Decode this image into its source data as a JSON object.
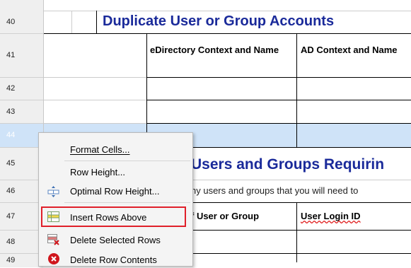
{
  "row_headers": [
    "40",
    "41",
    "42",
    "43",
    "44",
    "45",
    "46",
    "47",
    "48",
    "49"
  ],
  "sheet": {
    "section1_title": "Duplicate User or Group Accounts",
    "col_edirectory": "eDirectory Context and Name",
    "col_ad": "AD Context and Name",
    "section2_title": "Users and Groups Requirin",
    "section2_desc": "ny users and groups that you will need to",
    "col_user_or_group": "f User or Group",
    "col_user_login": "User Login ID"
  },
  "context_menu": {
    "items": [
      {
        "label": "Format Cells...",
        "icon": "none"
      },
      {
        "label": "Row Height...",
        "icon": "none"
      },
      {
        "label": "Optimal Row Height...",
        "icon": "optimal-row-height-icon"
      },
      {
        "label": "Insert Rows Above",
        "icon": "insert-rows-above-icon",
        "highlighted": true
      },
      {
        "label": "Delete Selected Rows",
        "icon": "delete-rows-icon"
      },
      {
        "label": "Delete Row Contents",
        "icon": "delete-row-contents-icon"
      }
    ]
  },
  "colors": {
    "title_blue": "#1a2a9a",
    "selected_row": "#cfe3f8",
    "highlight_border": "#e0202a"
  }
}
